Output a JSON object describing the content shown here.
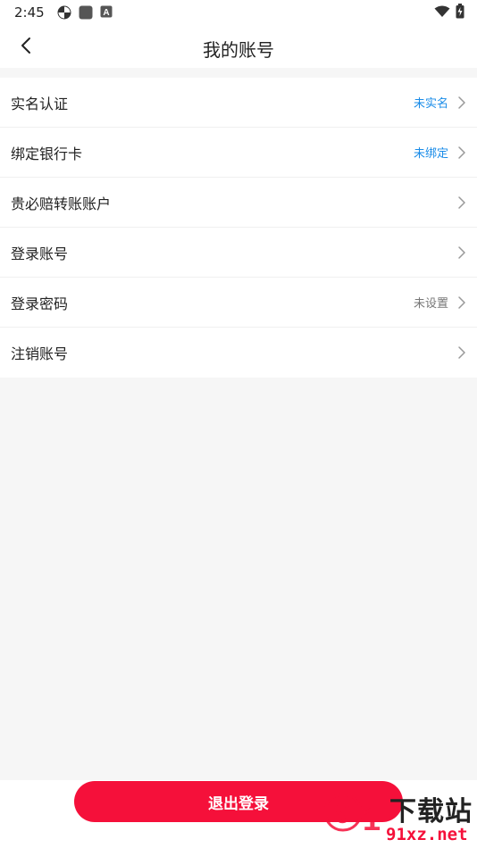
{
  "status_bar": {
    "time": "2:45",
    "left_icons": [
      "pinwheel-icon",
      "square-app-icon",
      "a-badge-icon"
    ],
    "right_icons": [
      "wifi-icon",
      "battery-icon"
    ]
  },
  "header": {
    "title": "我的账号",
    "back_icon": "chevron-left-icon"
  },
  "settings": {
    "items": [
      {
        "label": "实名认证",
        "value": "未实名",
        "value_color": "#1a8ce8"
      },
      {
        "label": "绑定银行卡",
        "value": "未绑定",
        "value_color": "#1a8ce8"
      },
      {
        "label": "贵必赔转账账户",
        "value": ""
      },
      {
        "label": "登录账号",
        "value": ""
      },
      {
        "label": "登录密码",
        "value": "未设置",
        "value_color": "#777777"
      },
      {
        "label": "注销账号",
        "value": ""
      }
    ]
  },
  "logout_button": {
    "label": "退出登录",
    "color": "#f5103a"
  },
  "watermark": {
    "text_top": "下载站",
    "text_bottom": "91xz.net"
  }
}
